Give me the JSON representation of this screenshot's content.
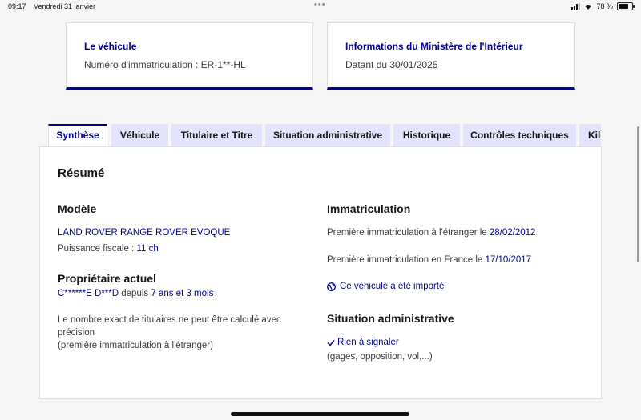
{
  "status": {
    "time": "09:17",
    "date": "Vendredi 31 janvier",
    "battery": "78 %",
    "battery_level": 0.78
  },
  "cards": [
    {
      "title": "Le véhicule",
      "text": "Numéro d'immatriculation : ER-1**-HL"
    },
    {
      "title": "Informations du Ministère de l'Intérieur",
      "text": "Datant du 30/01/2025"
    }
  ],
  "tabs": [
    {
      "label": "Synthèse",
      "active": true
    },
    {
      "label": "Véhicule"
    },
    {
      "label": "Titulaire et Titre"
    },
    {
      "label": "Situation administrative"
    },
    {
      "label": "Historique"
    },
    {
      "label": "Contrôles techniques"
    },
    {
      "label": "Kilométrage"
    }
  ],
  "summary": {
    "title": "Résumé",
    "modele": {
      "heading": "Modèle",
      "name": "LAND ROVER RANGE ROVER EVOQUE",
      "puissance_label": "Puissance fiscale : ",
      "puissance_value": "11 ch"
    },
    "proprietaire": {
      "heading": "Propriétaire actuel",
      "name": "C******E D***D",
      "depuis": " depuis ",
      "duree": "7 ans et 3 mois",
      "note_line1": "Le nombre exact de titulaires ne peut être calculé avec",
      "note_line2": "précision",
      "note_line3": "(première immatriculation à l'étranger)"
    },
    "immatriculation": {
      "heading": "Immatriculation",
      "etranger_label": "Première immatriculation à l'étranger le ",
      "etranger_date": "28/02/2012",
      "france_label": "Première immatriculation en France le ",
      "france_date": "17/10/2017",
      "importe": "Ce véhicule a été importé"
    },
    "situation": {
      "heading": "Situation administrative",
      "status": "Rien à signaler",
      "details": "(gages, opposition, vol,...)"
    }
  },
  "colors": {
    "accent": "#000091",
    "tab_bg": "#e3e3fd"
  }
}
